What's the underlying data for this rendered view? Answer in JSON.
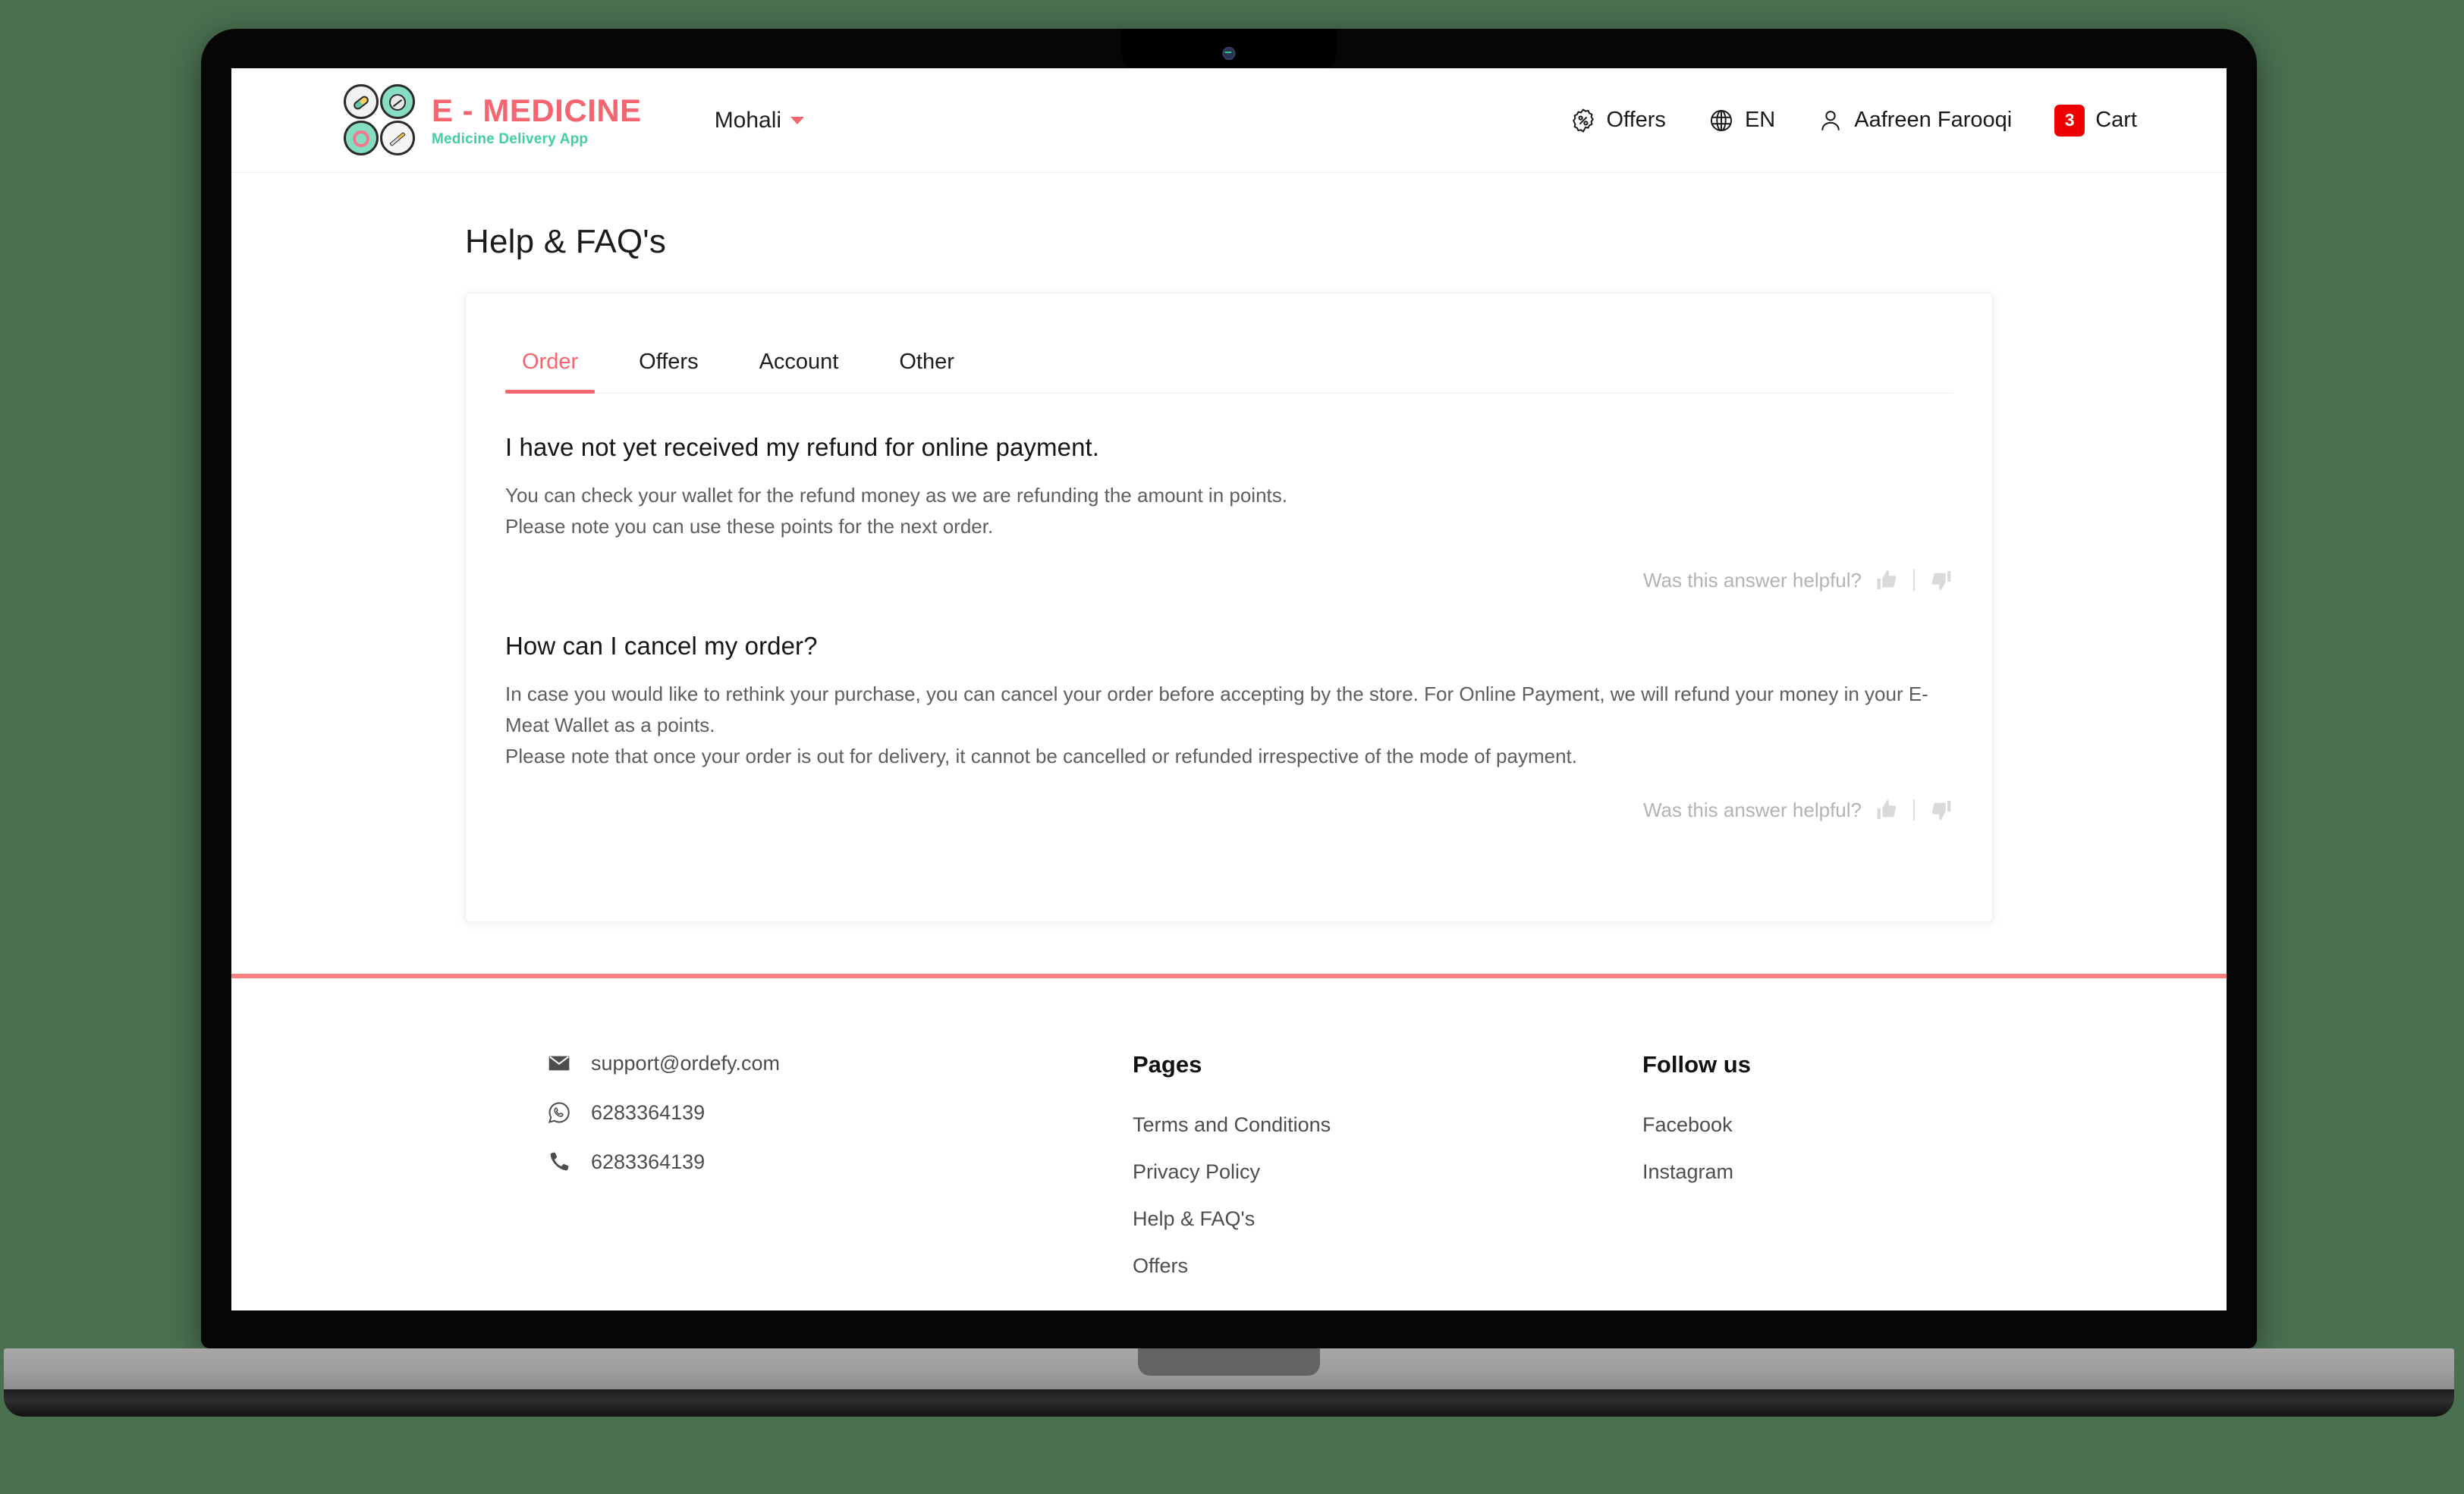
{
  "header": {
    "brand_name": "E - MEDICINE",
    "brand_tagline": "Medicine Delivery App",
    "brand_logo_icon": "medicine-petals-logo",
    "city": "Mohali",
    "city_chevron_icon": "chevron-down-icon",
    "nav": [
      {
        "label": "Offers",
        "icon": "discount-percent-icon"
      },
      {
        "label": "EN",
        "icon": "globe-icon"
      },
      {
        "label": "Aafreen Farooqi",
        "icon": "user-icon"
      }
    ],
    "cart": {
      "count": "3",
      "label": "Cart"
    }
  },
  "main": {
    "page_title": "Help & FAQ's",
    "tabs": [
      {
        "label": "Order",
        "active": true
      },
      {
        "label": "Offers",
        "active": false
      },
      {
        "label": "Account",
        "active": false
      },
      {
        "label": "Other",
        "active": false
      }
    ],
    "faqs": [
      {
        "question": "I have not yet received my refund for online payment.",
        "answer_line_1": "You can check your wallet for the refund money as we are refunding the amount in points.",
        "answer_line_2": "Please note you can use these points for the next order.",
        "helpful_label": "Was this answer helpful?",
        "thumbs_up_icon": "thumbs-up-icon",
        "thumbs_down_icon": "thumbs-down-icon"
      },
      {
        "question": "How can I cancel my order?",
        "answer_line_1": "In case you would like to rethink your purchase, you can cancel your order before accepting by the store. For Online Payment, we will refund your money in your E-Meat Wallet as a points.",
        "answer_line_2": "Please note that once your order is out for delivery, it cannot be cancelled or refunded irrespective of the mode of payment.",
        "helpful_label": "Was this answer helpful?",
        "thumbs_up_icon": "thumbs-up-icon",
        "thumbs_down_icon": "thumbs-down-icon"
      }
    ]
  },
  "footer": {
    "contact": [
      {
        "value": "support@ordefy.com",
        "icon": "email-icon"
      },
      {
        "value": "6283364139",
        "icon": "whatsapp-icon"
      },
      {
        "value": "6283364139",
        "icon": "phone-icon"
      }
    ],
    "pages": {
      "heading": "Pages",
      "links": [
        "Terms and Conditions",
        "Privacy Policy",
        "Help & FAQ's",
        "Offers"
      ]
    },
    "social": {
      "heading": "Follow us",
      "links": [
        "Facebook",
        "Instagram"
      ]
    }
  },
  "colors": {
    "background": "#4a7050",
    "brand_red": "#f5656f",
    "brand_teal": "#3fcfa3",
    "cart_badge": "#ef0000",
    "footer_divider": "#fb8080"
  }
}
